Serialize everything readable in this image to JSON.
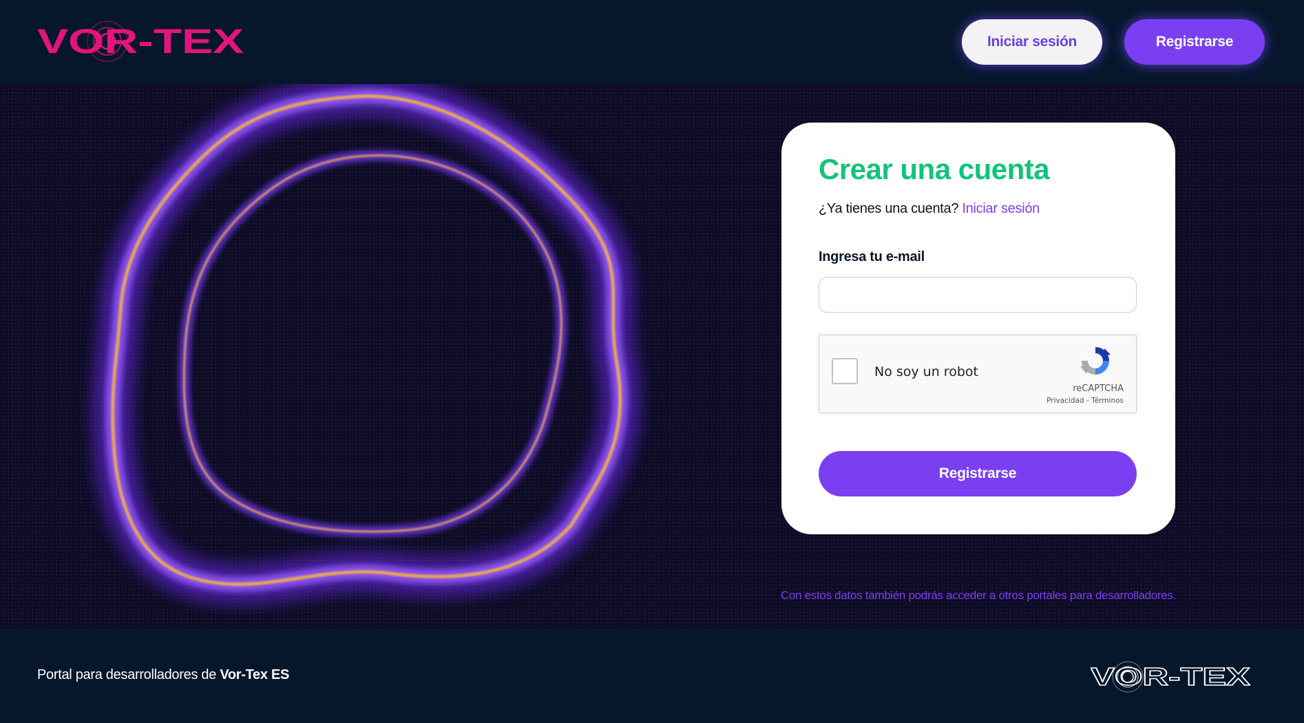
{
  "brand": {
    "name": "VOR-TEX",
    "primary_color": "#e5137c",
    "accent_color": "#7b3ff2",
    "success_color": "#10c47a",
    "dark_color": "#06172b"
  },
  "header": {
    "logo_text": "VOR-TEX",
    "login_label": "Iniciar sesión",
    "register_label": "Registrarse"
  },
  "hero": {
    "illustration": "glowing-wavy-rings"
  },
  "signup": {
    "title": "Crear una cuenta",
    "has_account_text": "¿Ya tienes una cuenta?",
    "login_link": "Iniciar sesión",
    "email_label": "Ingresa tu e-mail",
    "email_value": "",
    "email_placeholder": "",
    "recaptcha": {
      "checkbox_label": "No soy un robot",
      "brand": "reCAPTCHA",
      "privacy_link": "Privacidad",
      "separator": "-",
      "terms_link": "Términos",
      "icon": "recaptcha-icon"
    },
    "submit_label": "Registrarse",
    "note": "Con estos datos también podrás acceder a otros portales para desarrolladores."
  },
  "footer": {
    "text_prefix": "Portal para desarrolladores de ",
    "text_brand": "Vor-Tex ES",
    "logo_text": "VOR-TEX"
  }
}
